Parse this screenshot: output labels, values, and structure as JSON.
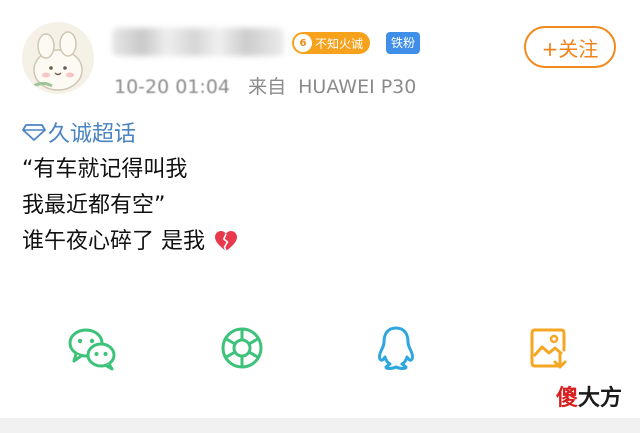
{
  "post": {
    "fan_badge": {
      "level": "6",
      "label": "不知火诚"
    },
    "tiefen_badge": "铁粉",
    "time": "10-20 01:04",
    "source_prefix": "来自",
    "device": "HUAWEI P30",
    "follow_label": "+关注",
    "topic": "久诚超话",
    "lines": [
      "“有车就记得叫我",
      "我最近都有空”",
      "谁午夜心碎了 是我"
    ]
  },
  "share": {
    "icons": [
      "wechat-icon",
      "moments-icon",
      "qq-icon",
      "save-image-icon"
    ]
  },
  "watermark": {
    "first": "傻",
    "rest": "大方"
  },
  "colors": {
    "accent_orange": "#f28a1e",
    "topic_blue": "#4a84c2",
    "wechat_green": "#3dc27a",
    "qq_blue": "#2ea7e0",
    "save_orange": "#f5a623"
  }
}
